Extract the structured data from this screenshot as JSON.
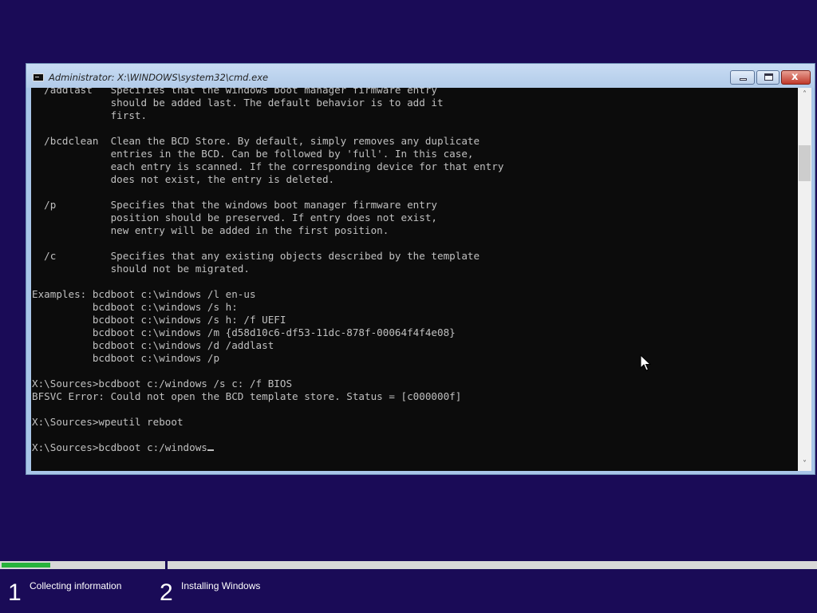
{
  "window": {
    "title": "Administrator: X:\\WINDOWS\\system32\\cmd.exe",
    "buttons": {
      "minimize": "minimize",
      "maximize": "maximize",
      "close": "x"
    }
  },
  "console": {
    "lines": [
      "  /addlast   Specifies that the windows boot manager firmware entry",
      "             should be added last. The default behavior is to add it",
      "             first.",
      "",
      "  /bcdclean  Clean the BCD Store. By default, simply removes any duplicate",
      "             entries in the BCD. Can be followed by 'full'. In this case,",
      "             each entry is scanned. If the corresponding device for that entry",
      "             does not exist, the entry is deleted.",
      "",
      "  /p         Specifies that the windows boot manager firmware entry",
      "             position should be preserved. If entry does not exist,",
      "             new entry will be added in the first position.",
      "",
      "  /c         Specifies that any existing objects described by the template",
      "             should not be migrated.",
      "",
      "Examples: bcdboot c:\\windows /l en-us",
      "          bcdboot c:\\windows /s h:",
      "          bcdboot c:\\windows /s h: /f UEFI",
      "          bcdboot c:\\windows /m {d58d10c6-df53-11dc-878f-00064f4f4e08}",
      "          bcdboot c:\\windows /d /addlast",
      "          bcdboot c:\\windows /p",
      "",
      "X:\\Sources>bcdboot c:/windows /s c: /f BIOS",
      "BFSVC Error: Could not open the BCD template store. Status = [c000000f]",
      "",
      "X:\\Sources>wpeutil reboot",
      ""
    ],
    "prompt": "X:\\Sources>",
    "input": "bcdboot c:/windows"
  },
  "setup": {
    "progress_fraction": 0.3,
    "steps": [
      {
        "number": "1",
        "label": "Collecting information"
      },
      {
        "number": "2",
        "label": "Installing Windows"
      }
    ]
  },
  "colors": {
    "desktop": "#1a0b57",
    "console_bg": "#0c0c0c",
    "console_fg": "#c0c0c0",
    "progress": "#27b23c"
  },
  "icons": {
    "window": "cmd-icon",
    "scroll_up": "chevron-up-icon",
    "scroll_down": "chevron-down-icon",
    "pointer": "mouse-pointer-icon"
  }
}
